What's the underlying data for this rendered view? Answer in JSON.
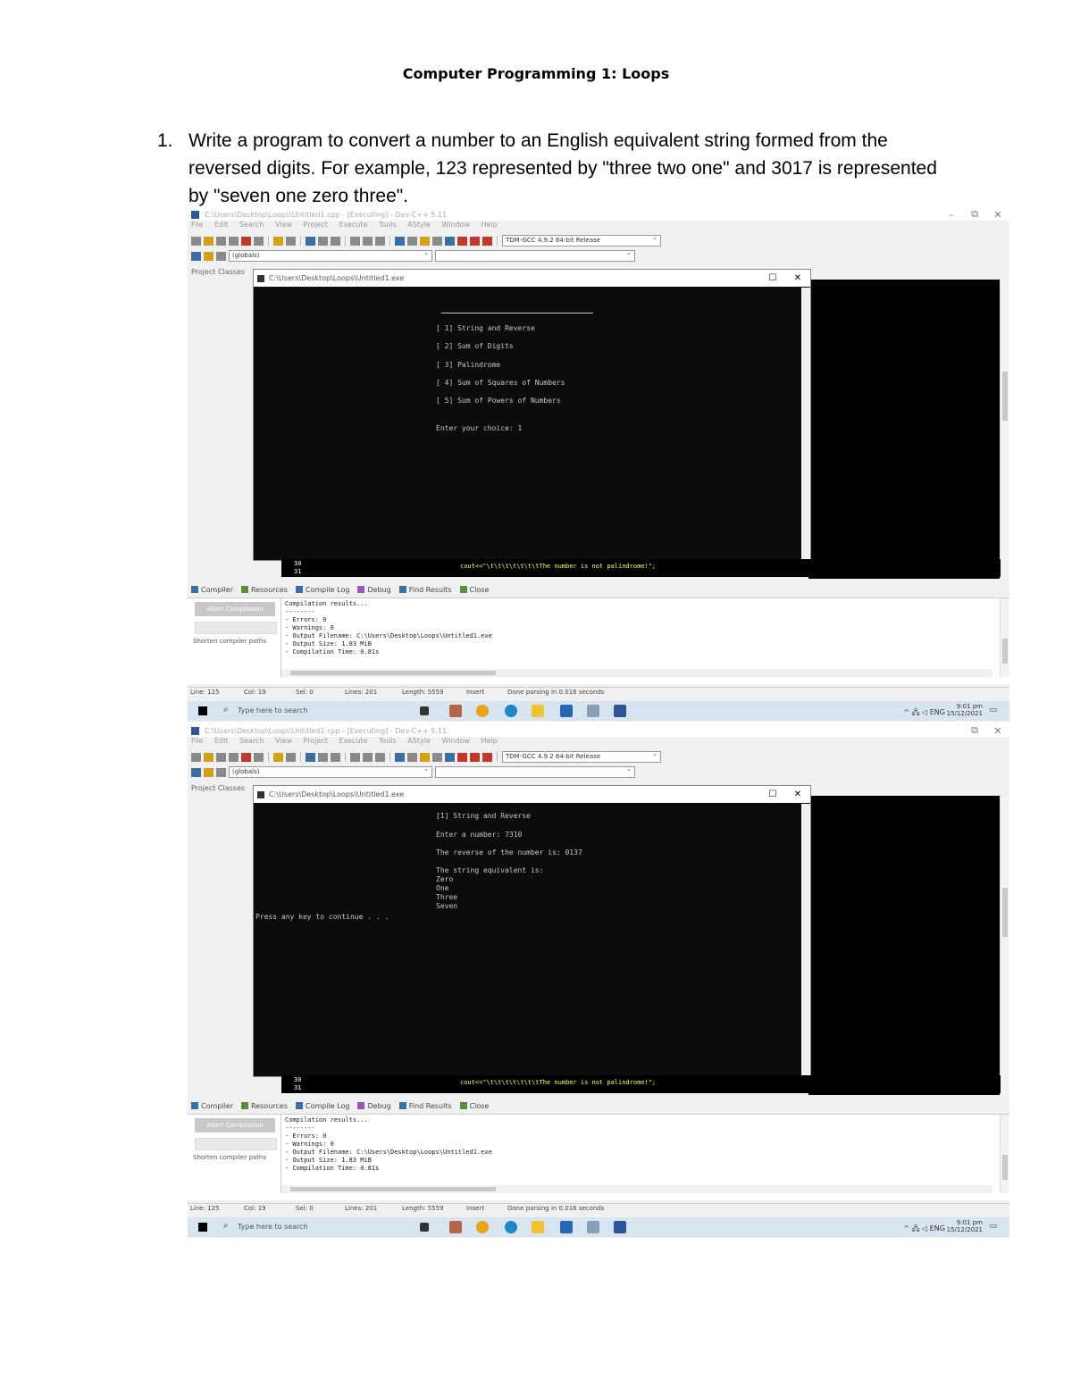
{
  "document": {
    "title": "Computer Programming 1: Loops",
    "question_number": "1.",
    "question_text": "Write a program to convert a number to an English equivalent string formed from the reversed digits. For example, 123 represented by \"three two one\" and 3017 is represented by \"seven one zero three\"."
  },
  "screenshot1": {
    "window_title": "C:\\Users\\Desktop\\Loops\\Untitled1.cpp - [Executing] - Dev-C++ 5.11",
    "menu": [
      "File",
      "Edit",
      "Search",
      "View",
      "Project",
      "Execute",
      "Tools",
      "AStyle",
      "Window",
      "Help"
    ],
    "compiler_combo": "TDM-GCC 4.9.2 64-bit Release",
    "globals_combo": "(globals)",
    "project_tabs": "Project  Classes",
    "console_title": "C:\\Users\\Desktop\\Loops\\Untitled1.exe",
    "console_lines": [
      "[ 1] String and Reverse",
      "[ 2] Sum of Digits",
      "[ 3] Palindrome",
      "[ 4] Sum of Squares of Numbers",
      "[ 5] Sum of Powers of Numbers",
      "Enter your choice: 1"
    ],
    "code_line_numbers": [
      "30",
      "31"
    ],
    "code_text": "cout<<\"\\t\\t\\t\\t\\t\\t\\tThe number is not palindrome!\";",
    "bottom_tabs": [
      "Compiler",
      "Resources",
      "Compile Log",
      "Debug",
      "Find Results",
      "Close"
    ],
    "abort_label": "Abort Compilation",
    "shortcut_option": "Shorten compiler paths",
    "log_lines": [
      "Compilation results...",
      "--------",
      "- Errors: 0",
      "- Warnings: 0",
      "- Output Filename: C:\\Users\\Desktop\\Loops\\Untitled1.exe",
      "- Output Size: 1.83 MiB",
      "- Compilation Time: 0.81s"
    ],
    "status": [
      "Line: 125",
      "Col: 19",
      "Sel: 0",
      "Lines: 201",
      "Length: 5559",
      "Insert",
      "Done parsing in 0.016 seconds"
    ],
    "search_placeholder": "Type here to search",
    "clock_time": "9:01 pm",
    "clock_date": "15/12/2021"
  },
  "screenshot2": {
    "window_title": "C:\\Users\\Desktop\\Loops\\Untitled1.cpp - [Executing] - Dev-C++ 5.11",
    "menu": [
      "File",
      "Edit",
      "Search",
      "View",
      "Project",
      "Execute",
      "Tools",
      "AStyle",
      "Window",
      "Help"
    ],
    "compiler_combo": "TDM-GCC 4.9.2 64-bit Release",
    "globals_combo": "(globals)",
    "project_tabs": "Project  Classes",
    "console_title": "C:\\Users\\Desktop\\Loops\\Untitled1.exe",
    "console_lines": [
      "[1] String and Reverse",
      "Enter a number: 7310",
      "The reverse of the number is: 0137",
      "The string equivalent is:",
      "Zero",
      "One",
      "Three",
      "Seven",
      "Press any key to continue . . ."
    ],
    "code_line_numbers": [
      "30",
      "31"
    ],
    "code_text": "cout<<\"\\t\\t\\t\\t\\t\\t\\tThe number is not palindrome!\";",
    "bottom_tabs": [
      "Compiler",
      "Resources",
      "Compile Log",
      "Debug",
      "Find Results",
      "Close"
    ],
    "abort_label": "Abort Compilation",
    "shortcut_option": "Shorten compiler paths",
    "log_lines": [
      "Compilation results...",
      "--------",
      "- Errors: 0",
      "- Warnings: 0",
      "- Output Filename: C:\\Users\\Desktop\\Loops\\Untitled1.exe",
      "- Output Size: 1.83 MiB",
      "- Compilation Time: 0.81s"
    ],
    "status": [
      "Line: 125",
      "Col: 19",
      "Sel: 0",
      "Lines: 201",
      "Length: 5559",
      "Insert",
      "Done parsing in 0.016 seconds"
    ],
    "search_placeholder": "Type here to search",
    "clock_time": "9:01 pm",
    "clock_date": "15/12/2021"
  },
  "colors": {
    "console_bg": "#0c0c0c",
    "editor_bg": "#000000",
    "code_highlight": "#ffff55",
    "taskbar": "#d9e4f1"
  }
}
